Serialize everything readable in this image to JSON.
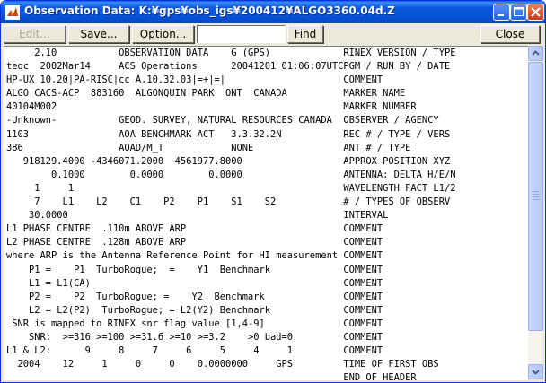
{
  "window": {
    "title": "Observation Data: K:¥gps¥obs_igs¥200412¥ALGO3360.04d.Z"
  },
  "toolbar": {
    "edit_label": "Edit...",
    "save_label": "Save...",
    "option_label": "Option...",
    "find_value": "",
    "find_label": "Find",
    "close_label": "Close"
  },
  "content": {
    "lines": [
      "     2.10           OBSERVATION DATA    G (GPS)             RINEX VERSION / TYPE",
      "teqc  2002Mar14     ACS Operations      20041201 01:06:07UTCPGM / RUN BY / DATE",
      "HP-UX 10.20|PA-RISC|cc A.10.32.03|=+|=|                     COMMENT",
      "ALGO CACS-ACP  883160  ALGONQUIN PARK  ONT  CANADA          MARKER NAME",
      "40104M002                                                   MARKER NUMBER",
      "-Unknown-           GEOD. SURVEY, NATURAL RESOURCES CANADA  OBSERVER / AGENCY",
      "1103                AOA BENCHMARK ACT   3.3.32.2N           REC # / TYPE / VERS",
      "386                 AOAD/M_T            NONE                ANT # / TYPE",
      "   918129.4000 -4346071.2000  4561977.8000                  APPROX POSITION XYZ",
      "        0.1000        0.0000        0.0000                  ANTENNA: DELTA H/E/N",
      "     1     1                                                WAVELENGTH FACT L1/2",
      "     7    L1    L2    C1    P2    P1    S1    S2            # / TYPES OF OBSERV",
      "    30.0000                                                 INTERVAL",
      "L1 PHASE CENTRE  .110m ABOVE ARP                            COMMENT",
      "L2 PHASE CENTRE  .128m ABOVE ARP                            COMMENT",
      "where ARP is the Antenna Reference Point for HI measurement COMMENT",
      "    P1 =    P1  TurboRogue;  =    Y1  Benchmark             COMMENT",
      "    L1 = L1(CA)                                             COMMENT",
      "    P2 =    P2  TurboRogue; =    Y2  Benchmark              COMMENT",
      "    L2 = L2(P2)  TurboRogue; = L2(Y2) Benchmark             COMMENT",
      " SNR is mapped to RINEX snr flag value [1,4-9]              COMMENT",
      "    SNR:  >=316 >=100 >=31.6 >=10 >=3.2    >0 bad=0         COMMENT",
      "L1 & L2:      9     8     7     6     5     4     1         COMMENT",
      "  2004    12     1     0     0    0.0000000     GPS         TIME OF FIRST OBS",
      "                                                            END OF HEADER"
    ]
  }
}
